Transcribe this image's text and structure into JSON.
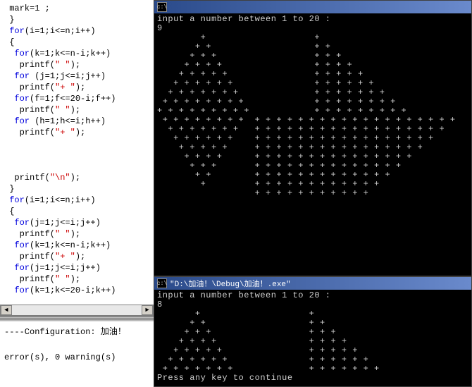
{
  "code": {
    "lines": [
      {
        "indent": 1,
        "plain": "mark=1 ;"
      },
      {
        "indent": 1,
        "plain": "}"
      },
      {
        "indent": 1,
        "kw": "for",
        "rest": "(i=1;i<=n;i++)"
      },
      {
        "indent": 1,
        "plain": "{"
      },
      {
        "indent": 2,
        "kw": "for",
        "rest": "(k=1;k<=n-i;k++)"
      },
      {
        "indent": 3,
        "call": "printf(",
        "str": "\" \"",
        "tail": ");"
      },
      {
        "indent": 2,
        "kw": "for",
        "rest": " (j=1;j<=i;j++)"
      },
      {
        "indent": 3,
        "call": "printf(",
        "str": "\"+ \"",
        "tail": ");"
      },
      {
        "indent": 2,
        "kw": "for",
        "rest": "(f=1;f<=20-i;f++)"
      },
      {
        "indent": 3,
        "call": "printf(",
        "str": "\" \"",
        "tail": ");"
      },
      {
        "indent": 2,
        "kw": "for",
        "rest": " (h=1;h<=i;h++)"
      },
      {
        "indent": 3,
        "call": "printf(",
        "str": "\"+ \"",
        "tail": ");"
      },
      {
        "indent": 0,
        "plain": ""
      },
      {
        "indent": 0,
        "plain": ""
      },
      {
        "indent": 0,
        "plain": ""
      },
      {
        "indent": 2,
        "call": "printf(",
        "str": "\"\\n\"",
        "tail": ");"
      },
      {
        "indent": 1,
        "plain": "}"
      },
      {
        "indent": 1,
        "kw": "for",
        "rest": "(i=1;i<=n;i++)"
      },
      {
        "indent": 1,
        "plain": "{"
      },
      {
        "indent": 2,
        "kw": "for",
        "rest": "(j=1;j<=i;j++)"
      },
      {
        "indent": 3,
        "call": "printf(",
        "str": "\" \"",
        "tail": ");"
      },
      {
        "indent": 2,
        "kw": "for",
        "rest": "(k=1;k<=n-i;k++)"
      },
      {
        "indent": 3,
        "call": "printf(",
        "str": "\"+ \"",
        "tail": ");"
      },
      {
        "indent": 2,
        "kw": "for",
        "rest": "(j=1;j<=i;j++)"
      },
      {
        "indent": 3,
        "call": "printf(",
        "str": "\" \"",
        "tail": ");"
      },
      {
        "indent": 2,
        "kw": "for",
        "rest": "(k=1;k<=20-i;k++)"
      }
    ]
  },
  "output": {
    "config_line": "----Configuration: 加油！",
    "status_line": "error(s), 0 warning(s)"
  },
  "console1": {
    "title": "",
    "prompt": "input a number between 1 to 20 :",
    "input_value": "9",
    "n": 9,
    "width": 20
  },
  "console2": {
    "title": "\"D:\\加油！\\Debug\\加油！.exe\"",
    "prompt": "input a number between 1 to 20 :",
    "input_value": "8",
    "n": 8,
    "width": 20,
    "footer": "Press any key to continue"
  }
}
